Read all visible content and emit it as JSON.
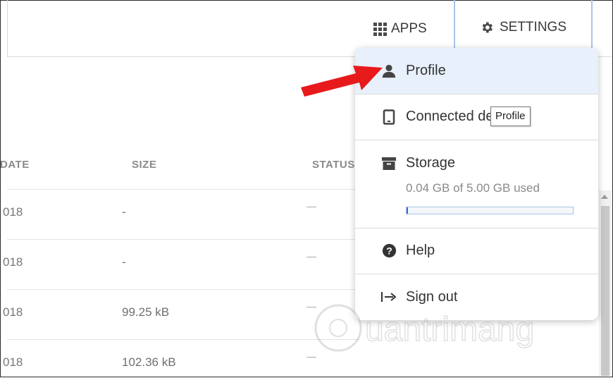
{
  "header": {
    "apps_label": "APPS",
    "settings_label": "SETTINGS"
  },
  "table": {
    "columns": [
      "DATE",
      "SIZE",
      "STATUS"
    ],
    "rows": [
      {
        "date": "018",
        "size": "-",
        "status": "—"
      },
      {
        "date": "018",
        "size": "-",
        "status": "—"
      },
      {
        "date": "018",
        "size": "99.25 kB",
        "status": "—"
      },
      {
        "date": "018",
        "size": "102.36 kB",
        "status": "—"
      }
    ]
  },
  "menu": {
    "profile": "Profile",
    "devices": "Connected devices",
    "storage": {
      "label": "Storage",
      "usage": "0.04 GB of 5.00 GB used",
      "used_fraction": 0.008
    },
    "help": "Help",
    "signout": "Sign out"
  },
  "tooltip": "Profile",
  "watermark": "uantrimang",
  "colors": {
    "accent": "#2f6fd1",
    "arrow": "#e8191b",
    "hover": "#e8f0fb"
  }
}
